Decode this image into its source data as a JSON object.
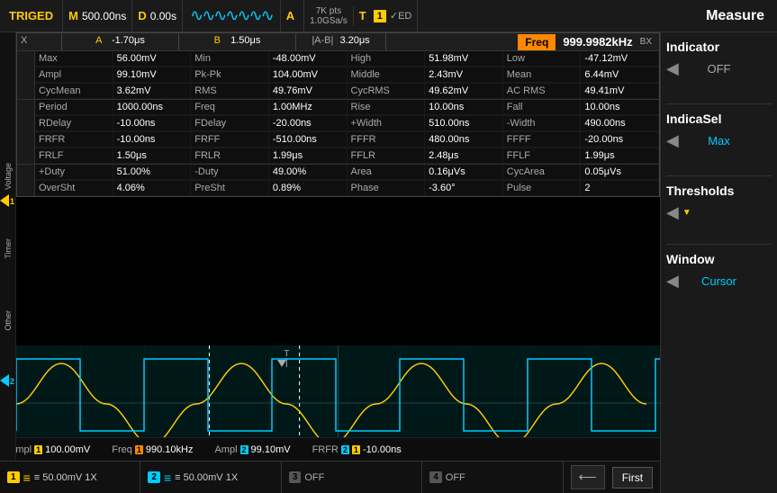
{
  "toolbar": {
    "trig_label": "TRIGED",
    "m_label": "M",
    "m_value": "500.00ns",
    "d_label": "D",
    "d_value": "0.00s",
    "waveform_icon": "〜〜〜",
    "a_label": "A",
    "pts_label": "7K pts",
    "sample_rate": "1.0GSa/s",
    "t_label": "T",
    "t_num": "1",
    "t_flags": "✓ED",
    "measure_title": "Measure"
  },
  "freq_box": {
    "label": "Freq",
    "value": "999.9982kHz",
    "sub": "BX"
  },
  "xrow": {
    "x_label": "X",
    "a_header": "A",
    "b_header": "B",
    "ab_header": "|A-B|",
    "a_val": "-1.70μs",
    "b_val": "1.50μs",
    "ab_val": "3.20μs"
  },
  "voltage_section": {
    "label": "Voltage",
    "rows": [
      [
        {
          "k": "Max",
          "v": "56.00mV"
        },
        {
          "k": "Min",
          "v": "-48.00mV"
        },
        {
          "k": "High",
          "v": "51.98mV"
        },
        {
          "k": "Low",
          "v": "-47.12mV"
        }
      ],
      [
        {
          "k": "Ampl",
          "v": "99.10mV"
        },
        {
          "k": "Pk-Pk",
          "v": "104.00mV"
        },
        {
          "k": "Middle",
          "v": "2.43mV"
        },
        {
          "k": "Mean",
          "v": "6.44mV"
        }
      ],
      [
        {
          "k": "CycMean",
          "v": "3.62mV"
        },
        {
          "k": "RMS",
          "v": "49.76mV"
        },
        {
          "k": "CycRMS",
          "v": "49.62mV"
        },
        {
          "k": "AC RMS",
          "v": "49.41mV"
        }
      ]
    ]
  },
  "timer_section": {
    "label": "Timer",
    "rows": [
      [
        {
          "k": "Period",
          "v": "1000.00ns"
        },
        {
          "k": "Freq",
          "v": "1.00MHz"
        },
        {
          "k": "Rise",
          "v": "10.00ns"
        },
        {
          "k": "Fall",
          "v": "10.00ns"
        }
      ],
      [
        {
          "k": "RDelay",
          "v": "-10.00ns"
        },
        {
          "k": "FDelay",
          "v": "-20.00ns"
        },
        {
          "k": "+Width",
          "v": "510.00ns"
        },
        {
          "k": "-Width",
          "v": "490.00ns"
        }
      ],
      [
        {
          "k": "FRFR",
          "v": "-10.00ns"
        },
        {
          "k": "FRFF",
          "v": "-510.00ns"
        },
        {
          "k": "FFFR",
          "v": "480.00ns"
        },
        {
          "k": "FFFF",
          "v": "-20.00ns"
        }
      ],
      [
        {
          "k": "FRLF",
          "v": "1.50μs"
        },
        {
          "k": "FRLR",
          "v": "1.99μs"
        },
        {
          "k": "FFLR",
          "v": "2.48μs"
        },
        {
          "k": "FFLF",
          "v": "1.99μs"
        }
      ]
    ]
  },
  "other_section": {
    "label": "Other",
    "rows": [
      [
        {
          "k": "+Duty",
          "v": "51.00%"
        },
        {
          "k": "-Duty",
          "v": "49.00%"
        },
        {
          "k": "Area",
          "v": "0.16μVs"
        },
        {
          "k": "CycArea",
          "v": "0.05μVs"
        }
      ],
      [
        {
          "k": "OverSht",
          "v": "4.06%"
        },
        {
          "k": "PreSht",
          "v": "0.89%"
        },
        {
          "k": "Phase",
          "v": "-3.60°"
        },
        {
          "k": "Pulse",
          "v": "2"
        }
      ]
    ]
  },
  "right_panel": {
    "indicator_title": "Indicator",
    "indicator_value": "OFF",
    "indicasel_title": "IndicaSel",
    "indicasel_value": "Max",
    "thresholds_title": "Thresholds",
    "window_title": "Window",
    "window_value": "Cursor"
  },
  "bottom_meas": [
    {
      "param": "Ampl",
      "badge": "1",
      "badge_color": "#ffcc00",
      "val": "100.00mV"
    },
    {
      "param": "Freq",
      "badge": "1",
      "badge_color": "#ff8800",
      "val": "990.10kHz"
    },
    {
      "param": "Ampl",
      "badge": "2",
      "badge_color": "#00ccff",
      "val": "99.10mV"
    },
    {
      "param": "FRFR",
      "badge": "2",
      "badge_color": "#00ccff",
      "badge2": "1",
      "val": "-10.00ns"
    }
  ],
  "channel_buttons": [
    {
      "num": "1",
      "label": "≡ 50.00mV 1X",
      "color": "#ffcc00"
    },
    {
      "num": "2",
      "label": "≡ 50.00mV 1X",
      "color": "#00ccff"
    },
    {
      "num": "3",
      "label": "OFF",
      "color": "#888"
    },
    {
      "num": "4",
      "label": "OFF",
      "color": "#888"
    }
  ],
  "nav_buttons": {
    "back_label": "⟵",
    "first_label": "First"
  }
}
